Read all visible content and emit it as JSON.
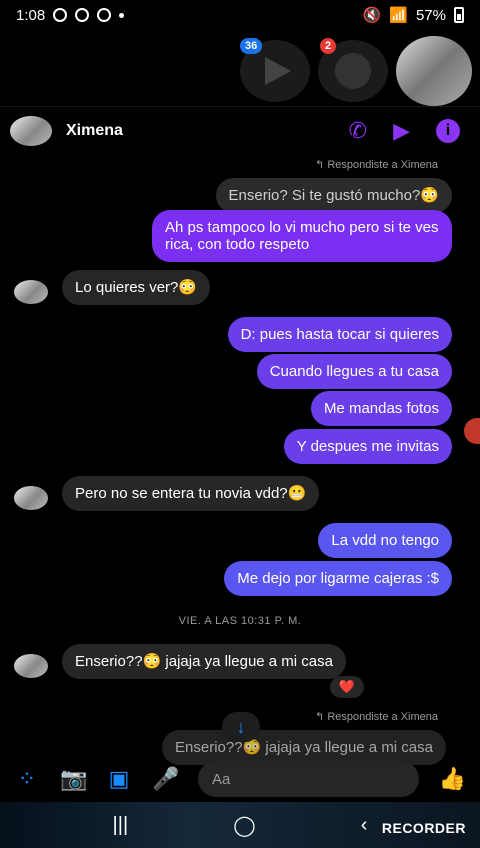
{
  "status": {
    "time": "1:08",
    "battery": "57%"
  },
  "chat_heads": [
    {
      "badge": "36",
      "icon": "play-icon"
    },
    {
      "badge": "2",
      "icon": "messenger-icon"
    },
    {
      "icon": "avatar"
    }
  ],
  "header": {
    "title": "Ximena"
  },
  "messages": {
    "reply_note_1": "Respondiste a Ximena",
    "quoted_1": "Enserio? Si te gustó mucho?😳",
    "m1": "Ah ps tampoco lo vi mucho pero si te ves rica, con todo respeto",
    "m2": "Lo quieres ver?😳",
    "m3": "D: pues hasta tocar si quieres",
    "m4": "Cuando llegues a tu casa",
    "m5": "Me mandas fotos",
    "m6": "Y despues me invitas",
    "m7": "Pero no se entera tu novia vdd?😬",
    "m8": "La vdd no tengo",
    "m9": "Me dejo por ligarme cajeras :$",
    "timestamp": "VIE. A LAS 10:31 P. M.",
    "m10": "Enserio??😳 jajaja ya llegue a mi casa",
    "reaction": "❤️",
    "reply_note_2": "Respondiste a Ximena",
    "quoted_2": "Enserio??😳 jajaja ya llegue a mi casa"
  },
  "composer": {
    "placeholder": "Aa"
  },
  "watermark": "RECORDER"
}
